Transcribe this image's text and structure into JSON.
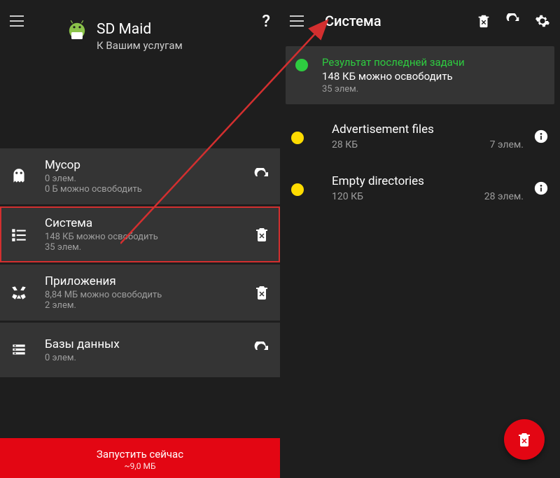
{
  "left": {
    "brand_title": "SD Maid",
    "brand_sub": "К Вашим услугам",
    "items": [
      {
        "title": "Мусор",
        "sub": "0 элем.",
        "sub2": "0 Б можно освободить",
        "action": "refresh"
      },
      {
        "title": "Система",
        "sub": "148 КБ можно освободить",
        "sub2": "35 элем.",
        "action": "delete",
        "highlight": true
      },
      {
        "title": "Приложения",
        "sub": "8,84 МБ можно освободить",
        "sub2": "2 элем.",
        "action": "delete"
      },
      {
        "title": "Базы данных",
        "sub": "0 элем.",
        "sub2": "",
        "action": "refresh"
      }
    ],
    "run_title": "Запустить сейчас",
    "run_sub": "~9,0 МБ"
  },
  "right": {
    "header_title": "Система",
    "summary": {
      "title": "Результат последней задачи",
      "line": "148 КБ можно освободить",
      "sub": "35 элем."
    },
    "rows": [
      {
        "title": "Advertisement files",
        "size": "28 КБ",
        "count": "7 элем."
      },
      {
        "title": "Empty directories",
        "size": "120 КБ",
        "count": "28 элем."
      }
    ]
  }
}
